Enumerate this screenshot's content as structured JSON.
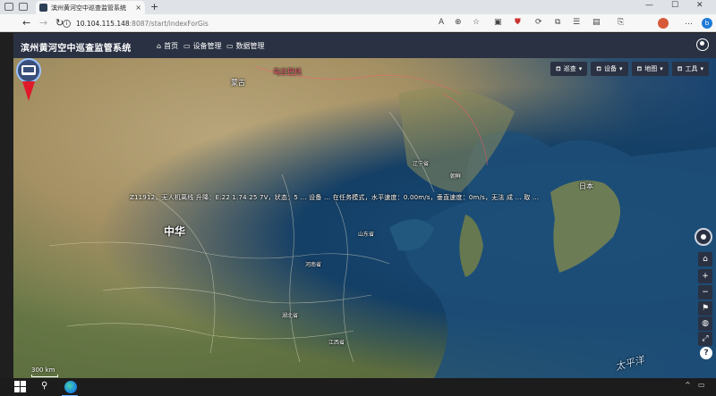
{
  "browser": {
    "tab_title": "滨州黄河空中巡查监管系统",
    "tab_close": "×",
    "new_tab": "+",
    "url_host": "10.104.115.148",
    "url_path": ":8087/start/indexForGis",
    "nav_back": "←",
    "nav_forward": "→",
    "nav_refresh": "↻",
    "minimize": "—",
    "maximize": "☐",
    "close": "✕"
  },
  "app": {
    "title": "滨州黄河空中巡查监管系统",
    "nav": [
      {
        "label": "首页",
        "icon": "home-icon"
      },
      {
        "label": "设备管理",
        "icon": "folder-icon"
      },
      {
        "label": "数据管理",
        "icon": "folder-icon"
      }
    ]
  },
  "map": {
    "tools": [
      {
        "label": "巡查"
      },
      {
        "label": "设备"
      },
      {
        "label": "地图"
      },
      {
        "label": "工具"
      }
    ],
    "status_text": "Z11912，无人机离线  升降：E:22 1.74 25 7V，状态：5 ... 设备 ... 在任务模式，水平速度：0.00m/s，垂直速度：0m/s，无法 成 ... 取 ... ",
    "labels": [
      {
        "text": "中华",
        "cls": "big"
      },
      {
        "text": "蒙古",
        "cls": "med"
      },
      {
        "text": "日本",
        "cls": "med"
      },
      {
        "text": "朝鲜",
        "cls": "sm"
      },
      {
        "text": "山东省",
        "cls": "sm"
      },
      {
        "text": "河南省",
        "cls": "sm"
      },
      {
        "text": "湖北省",
        "cls": "sm"
      },
      {
        "text": "江西省",
        "cls": "sm"
      },
      {
        "text": "辽宁省",
        "cls": "sm"
      },
      {
        "text": "太平洋",
        "cls": "sea"
      }
    ],
    "scale_label": "300 km",
    "help": "?"
  },
  "taskbar": {
    "search": "⚲",
    "chevron": "^",
    "tray": "▭"
  }
}
